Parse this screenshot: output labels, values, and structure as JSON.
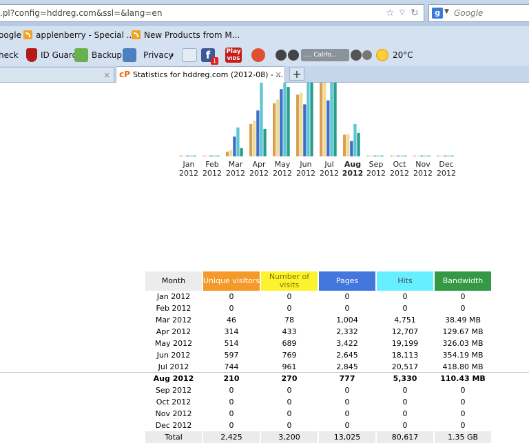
{
  "browser": {
    "url": ".pl?config=hddreg.com&ssl=&lang=en",
    "search_placeholder": "Google",
    "google_badge": "g"
  },
  "bookmarks": [
    {
      "label": "oogle"
    },
    {
      "label": "applenberry - Special ..."
    },
    {
      "label": "New Products from M..."
    }
  ],
  "toolbar": {
    "check": "heck",
    "id_guard": "ID Guard",
    "backup": "Backup",
    "privacy": "Privacy",
    "fb_badge": "f",
    "fb_count": "1",
    "play_vids": "Play",
    "play_vids_sub": "VIDS",
    "radio_station": ".... Califo...",
    "weather": "20°C"
  },
  "tabs": {
    "active_title": "Statistics for hddreg.com (2012-08) - ...",
    "cp_icon": "cP",
    "close_symbol": "×",
    "new_tab_symbol": "+"
  },
  "colors": {
    "unique": "#f6992b",
    "visits": "#fcf32e",
    "pages": "#4477dd",
    "hits": "#66f0ff",
    "bandwidth": "#339944",
    "bar_unique": "#d9a052",
    "bar_visits": "#eedd99",
    "bar_pages": "#3f6ec8",
    "bar_hits": "#5bc7d3",
    "bar_bandwidth": "#2a9c8c"
  },
  "chart_data": {
    "type": "bar",
    "categories": [
      "Jan 2012",
      "Feb 2012",
      "Mar 2012",
      "Apr 2012",
      "May 2012",
      "Jun 2012",
      "Jul 2012",
      "Aug 2012",
      "Sep 2012",
      "Oct 2012",
      "Nov 2012",
      "Dec 2012"
    ],
    "highlight": "Aug 2012",
    "series": [
      {
        "name": "Unique visitors",
        "values": [
          0,
          0,
          46,
          314,
          514,
          597,
          744,
          210,
          0,
          0,
          0,
          0
        ]
      },
      {
        "name": "Number of visits",
        "values": [
          0,
          0,
          78,
          433,
          689,
          769,
          961,
          270,
          0,
          0,
          0,
          0
        ]
      },
      {
        "name": "Pages",
        "values": [
          0,
          0,
          1004,
          2332,
          3422,
          2645,
          2845,
          777,
          0,
          0,
          0,
          0
        ]
      },
      {
        "name": "Hits",
        "values": [
          0,
          0,
          4751,
          12707,
          19199,
          18113,
          20517,
          5330,
          0,
          0,
          0,
          0
        ]
      },
      {
        "name": "Bandwidth",
        "values": [
          0,
          0,
          38.49,
          129.67,
          326.03,
          354.19,
          418.8,
          110.43,
          0,
          0,
          0,
          0
        ]
      }
    ],
    "note": "bars clipped at top of visible area"
  },
  "table": {
    "headers": {
      "month": "Month",
      "unique": "Unique visitors",
      "visits": "Number of visits",
      "pages": "Pages",
      "hits": "Hits",
      "bandwidth": "Bandwidth"
    },
    "rows": [
      {
        "month": "Jan 2012",
        "unique": "0",
        "visits": "0",
        "pages": "0",
        "hits": "0",
        "bandwidth": "0"
      },
      {
        "month": "Feb 2012",
        "unique": "0",
        "visits": "0",
        "pages": "0",
        "hits": "0",
        "bandwidth": "0"
      },
      {
        "month": "Mar 2012",
        "unique": "46",
        "visits": "78",
        "pages": "1,004",
        "hits": "4,751",
        "bandwidth": "38.49 MB"
      },
      {
        "month": "Apr 2012",
        "unique": "314",
        "visits": "433",
        "pages": "2,332",
        "hits": "12,707",
        "bandwidth": "129.67 MB"
      },
      {
        "month": "May 2012",
        "unique": "514",
        "visits": "689",
        "pages": "3,422",
        "hits": "19,199",
        "bandwidth": "326.03 MB"
      },
      {
        "month": "Jun 2012",
        "unique": "597",
        "visits": "769",
        "pages": "2,645",
        "hits": "18,113",
        "bandwidth": "354.19 MB"
      },
      {
        "month": "Jul 2012",
        "unique": "744",
        "visits": "961",
        "pages": "2,845",
        "hits": "20,517",
        "bandwidth": "418.80 MB"
      },
      {
        "month": "Aug 2012",
        "unique": "210",
        "visits": "270",
        "pages": "777",
        "hits": "5,330",
        "bandwidth": "110.43 MB"
      },
      {
        "month": "Sep 2012",
        "unique": "0",
        "visits": "0",
        "pages": "0",
        "hits": "0",
        "bandwidth": "0"
      },
      {
        "month": "Oct 2012",
        "unique": "0",
        "visits": "0",
        "pages": "0",
        "hits": "0",
        "bandwidth": "0"
      },
      {
        "month": "Nov 2012",
        "unique": "0",
        "visits": "0",
        "pages": "0",
        "hits": "0",
        "bandwidth": "0"
      },
      {
        "month": "Dec 2012",
        "unique": "0",
        "visits": "0",
        "pages": "0",
        "hits": "0",
        "bandwidth": "0"
      }
    ],
    "current_month": "Aug 2012",
    "total": {
      "label": "Total",
      "unique": "2,425",
      "visits": "3,200",
      "pages": "13,025",
      "hits": "80,617",
      "bandwidth": "1.35 GB"
    }
  }
}
